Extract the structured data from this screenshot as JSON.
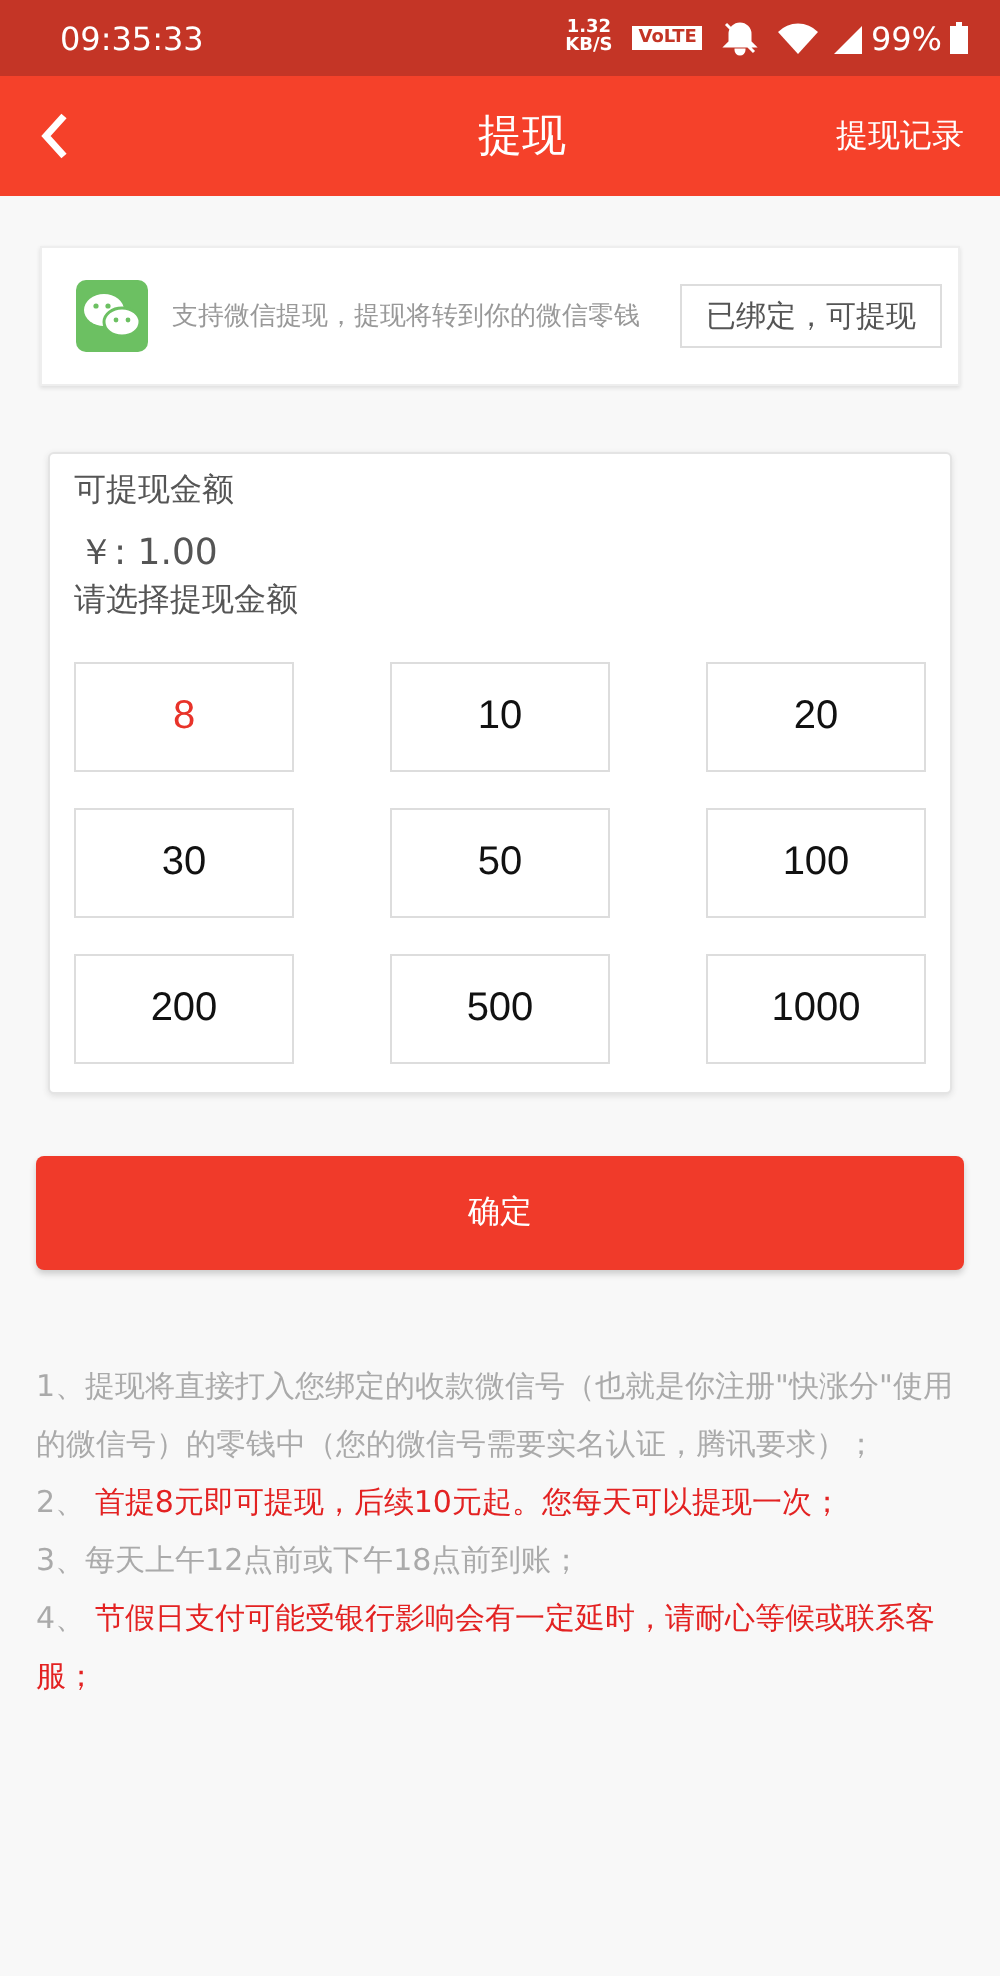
{
  "status_bar": {
    "time": "09:35:33",
    "speed_value": "1.32",
    "speed_unit": "KB/S",
    "volte": "VoLTE",
    "battery": "99%"
  },
  "header": {
    "title": "提现",
    "action": "提现记录"
  },
  "wechat": {
    "description": "支持微信提现，提现将转到你的微信零钱",
    "status": "已绑定，可提现"
  },
  "balance": {
    "label": "可提现金额",
    "amount": "￥: 1.00",
    "prompt": "请选择提现金额"
  },
  "amounts": [
    {
      "label": "8",
      "selected": true
    },
    {
      "label": "10",
      "selected": false
    },
    {
      "label": "20",
      "selected": false
    },
    {
      "label": "30",
      "selected": false
    },
    {
      "label": "50",
      "selected": false
    },
    {
      "label": "100",
      "selected": false
    },
    {
      "label": "200",
      "selected": false
    },
    {
      "label": "500",
      "selected": false
    },
    {
      "label": "1000",
      "selected": false
    }
  ],
  "confirm": "确定",
  "notes": [
    {
      "number": "1、",
      "text": "提现将直接打入您绑定的收款微信号（也就是你注册\"快涨分\"使用的微信号）的零钱中（您的微信号需要实名认证，腾讯要求）；",
      "highlight": false
    },
    {
      "number": "2、 ",
      "text": "首提8元即可提现，后续10元起。您每天可以提现一次；",
      "highlight": true
    },
    {
      "number": "3、",
      "text": "每天上午12点前或下午18点前到账；",
      "highlight": false
    },
    {
      "number": "4、 ",
      "text": "节假日支付可能受银行影响会有一定延时，请耐心等候或联系客服；",
      "highlight": true
    }
  ]
}
